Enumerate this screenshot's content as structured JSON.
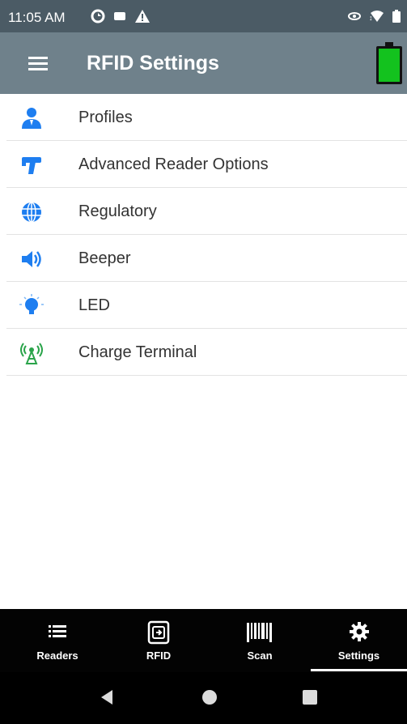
{
  "status_bar": {
    "time": "11:05 AM",
    "left_icons": [
      "sync-icon",
      "message-icon",
      "warning-icon"
    ],
    "right_icons": [
      "nfc-icon",
      "wifi-icon",
      "battery-small-icon"
    ]
  },
  "app_bar": {
    "title": "RFID Settings",
    "battery_level": 1.0,
    "battery_color": "#13c21e"
  },
  "settings": {
    "items": [
      {
        "label": "Profiles",
        "icon": "profile-icon",
        "color": "#1e7ef0"
      },
      {
        "label": "Advanced Reader Options",
        "icon": "reader-gun-icon",
        "color": "#1e7ef0"
      },
      {
        "label": "Regulatory",
        "icon": "globe-icon",
        "color": "#1e7ef0"
      },
      {
        "label": "Beeper",
        "icon": "speaker-icon",
        "color": "#1e7ef0"
      },
      {
        "label": "LED",
        "icon": "led-bulb-icon",
        "color": "#1e7ef0"
      },
      {
        "label": "Charge Terminal",
        "icon": "charge-terminal-icon",
        "color": "#2aa44a"
      }
    ]
  },
  "bottom_nav": {
    "tabs": [
      {
        "label": "Readers",
        "icon": "list-icon"
      },
      {
        "label": "RFID",
        "icon": "rfid-tag-icon"
      },
      {
        "label": "Scan",
        "icon": "barcode-icon"
      },
      {
        "label": "Settings",
        "icon": "gear-icon"
      }
    ],
    "active_tab": "Settings"
  },
  "system_nav": {
    "buttons": [
      "back-icon",
      "home-icon",
      "recents-icon"
    ]
  }
}
